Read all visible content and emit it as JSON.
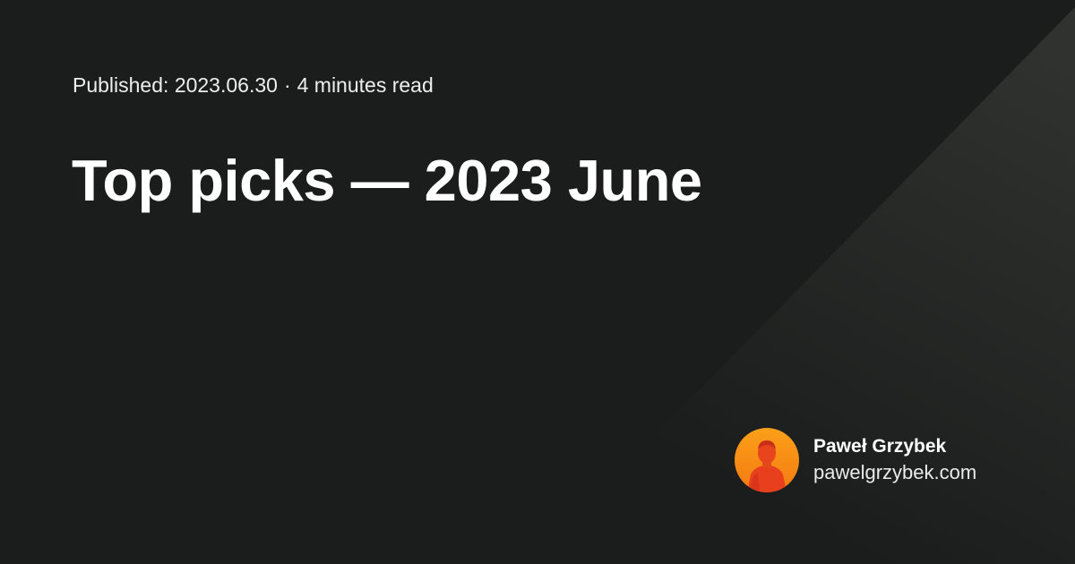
{
  "meta": {
    "published_label": "Published:",
    "date": "2023.06.30",
    "separator": "·",
    "reading_time": "4 minutes read"
  },
  "title": "Top picks — 2023 June",
  "author": {
    "name": "Paweł Grzybek",
    "website": "pawelgrzybek.com"
  },
  "colors": {
    "background": "#1b1d1d",
    "diagonal_highlight": "#2e302f",
    "avatar_orange": "#f89a16",
    "avatar_red": "#e8401c"
  },
  "icons": {
    "avatar": "author-photo-icon"
  }
}
